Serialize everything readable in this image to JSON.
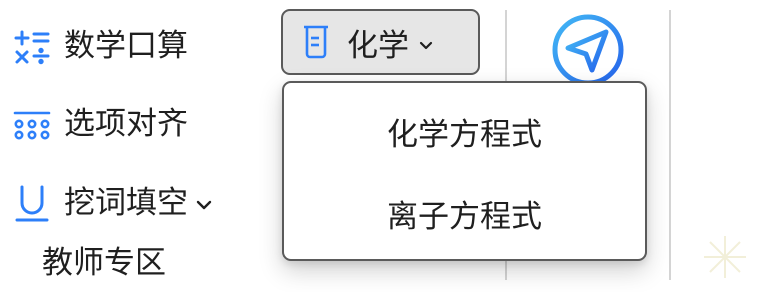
{
  "sidebar": {
    "items": [
      {
        "label": "数学口算",
        "icon": "calculator-symbols-icon"
      },
      {
        "label": "选项对齐",
        "icon": "dot-grid-icon"
      },
      {
        "label": "挖词填空",
        "icon": "underline-u-icon",
        "has_dropdown": true
      }
    ],
    "section_label": "教师专区"
  },
  "subject_select": {
    "label": "化学",
    "icon": "beaker-icon",
    "expanded": true,
    "options": [
      "化学方程式",
      "离子方程式"
    ]
  },
  "send": {
    "icon": "send-plane-icon"
  },
  "colors": {
    "accent_blue": "#2d7ff9",
    "button_bg": "#e6e6e6",
    "border": "#5a5a5a",
    "text": "#1f1f1f"
  }
}
